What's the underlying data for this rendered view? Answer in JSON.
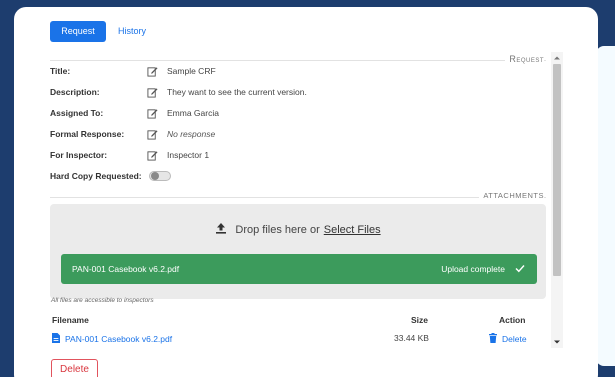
{
  "tabs": [
    {
      "label": "Request",
      "active": true
    },
    {
      "label": "History",
      "active": false
    }
  ],
  "sections": {
    "request": "Request",
    "attachments": "ATTACHMENTS"
  },
  "fields": {
    "title": {
      "label": "Title:",
      "value": "Sample CRF"
    },
    "description": {
      "label": "Description:",
      "value": "They want to see the current version."
    },
    "assigned_to": {
      "label": "Assigned To:",
      "value": "Emma Garcia"
    },
    "formal_response": {
      "label": "Formal Response:",
      "value": "No response"
    },
    "for_inspector": {
      "label": "For Inspector:",
      "value": "Inspector 1"
    },
    "hard_copy": {
      "label": "Hard Copy Requested:",
      "checked": false
    }
  },
  "dropzone": {
    "prefix": "Drop files here or",
    "link": "Select Files"
  },
  "upload": {
    "filename": "PAN-001 Casebook v6.2.pdf",
    "status": "Upload complete"
  },
  "note": "All files are accessible to inspectors",
  "table": {
    "headers": {
      "filename": "Filename",
      "size": "Size",
      "action": "Action"
    },
    "rows": [
      {
        "filename": "PAN-001 Casebook v6.2.pdf",
        "size": "33.44 KB",
        "action": "Delete"
      }
    ]
  },
  "footer": {
    "delete_label": "Delete"
  },
  "colors": {
    "accent": "#1a73e8",
    "success": "#3c9b5c",
    "danger": "#d9363e",
    "background": "#1d3d6e"
  },
  "icons": [
    "edit-icon",
    "upload-icon",
    "check-icon",
    "file-pdf-icon",
    "trash-icon"
  ]
}
